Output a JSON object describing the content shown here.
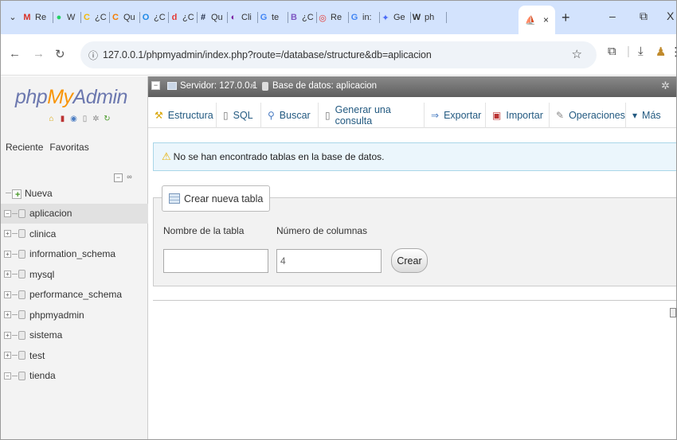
{
  "browser": {
    "tabs": [
      {
        "icon": "gmail-icon",
        "text": "Re",
        "color": "#d93025",
        "glyph": "M"
      },
      {
        "icon": "whatsapp-icon",
        "text": "W",
        "color": "#25d366",
        "glyph": "●"
      },
      {
        "icon": "tab-c-icon",
        "text": "¿C",
        "color": "#f2b705",
        "glyph": "C"
      },
      {
        "icon": "tab-q-icon",
        "text": "Qu",
        "color": "#f57c00",
        "glyph": "C"
      },
      {
        "icon": "tab-c2-icon",
        "text": "¿C",
        "color": "#1e88e5",
        "glyph": "O"
      },
      {
        "icon": "tab-d-icon",
        "text": "¿C",
        "color": "#e53935",
        "glyph": "d"
      },
      {
        "icon": "tab-hash-icon",
        "text": "Qu",
        "color": "#1f2a44",
        "glyph": "#"
      },
      {
        "icon": "tab-cl-icon",
        "text": "Cli",
        "color": "#7b1fa2",
        "glyph": "◐"
      },
      {
        "icon": "google-icon",
        "text": "te",
        "color": "#4285f4",
        "glyph": "G"
      },
      {
        "icon": "tab-b-icon",
        "text": "¿C",
        "color": "#7e57c2",
        "glyph": "B"
      },
      {
        "icon": "tab-re-icon",
        "text": "Re",
        "color": "#e53935",
        "glyph": "◎"
      },
      {
        "icon": "google-icon",
        "text": "in:",
        "color": "#4285f4",
        "glyph": "G"
      },
      {
        "icon": "gemini-icon",
        "text": "Ge",
        "color": "#4b6cf7",
        "glyph": "✦"
      },
      {
        "icon": "wikipedia-icon",
        "text": "ph",
        "color": "#333333",
        "glyph": "W"
      }
    ],
    "active_tab_close": "×",
    "new_tab": "+",
    "minimize": "–",
    "restore": "⧉",
    "close": "X",
    "url": "127.0.0.1/phpmyadmin/index.php?route=/database/structure&db=aplicacion"
  },
  "sidebar": {
    "logo_php": "php",
    "logo_my": "My",
    "logo_admin": "Admin",
    "tab_recent": "Reciente",
    "tab_favorites": "Favoritas",
    "new_item": "Nueva",
    "databases": [
      "aplicacion",
      "clinica",
      "information_schema",
      "mysql",
      "performance_schema",
      "phpmyadmin",
      "sistema",
      "test",
      "tienda"
    ]
  },
  "main": {
    "breadcrumb_server": "Servidor: 127.0.0.1",
    "breadcrumb_arrow": "»",
    "breadcrumb_db": "Base de datos: aplicacion",
    "menu": {
      "estructura": "Estructura",
      "sql": "SQL",
      "buscar": "Buscar",
      "consulta": "Generar una consulta",
      "exportar": "Exportar",
      "importar": "Importar",
      "operaciones": "Operaciones",
      "mas": "Más"
    },
    "notice": "No se han encontrado tablas en la base de datos.",
    "create_table": {
      "legend": "Crear nueva tabla",
      "name_label": "Nombre de la tabla",
      "cols_label": "Número de columnas",
      "name_value": "",
      "cols_value": "4",
      "button": "Crear"
    }
  },
  "colors": {
    "accent_link": "#235a81",
    "tab_strip": "#d3e3fd",
    "notice_bg": "#ebf6fc"
  }
}
